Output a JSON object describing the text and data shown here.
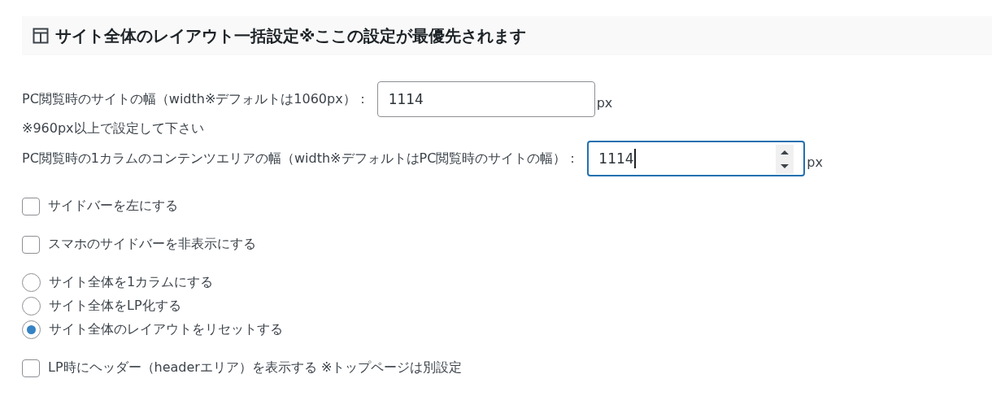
{
  "section": {
    "title": "サイト全体のレイアウト一括設定※ここの設定が最優先されます"
  },
  "fields": [
    {
      "label": "PC閲覧時のサイトの幅（width※デフォルトは1060px）：",
      "value": "1114",
      "unit": "px",
      "focused": false,
      "spinner": false,
      "note": "※960px以上で設定して下さい"
    },
    {
      "label": "PC閲覧時の1カラムのコンテンツエリアの幅（width※デフォルトはPC閲覧時のサイトの幅）：",
      "value": "1114",
      "unit": "px",
      "focused": true,
      "spinner": true
    }
  ],
  "option_groups": [
    [
      {
        "kind": "checkbox",
        "label": "サイドバーを左にする",
        "checked": false
      }
    ],
    [
      {
        "kind": "checkbox",
        "label": "スマホのサイドバーを非表示にする",
        "checked": false
      }
    ],
    [
      {
        "kind": "radio",
        "label": "サイト全体を1カラムにする",
        "selected": false
      },
      {
        "kind": "radio",
        "label": "サイト全体をLP化する",
        "selected": false
      },
      {
        "kind": "radio",
        "label": "サイト全体のレイアウトをリセットする",
        "selected": true
      }
    ],
    [
      {
        "kind": "checkbox",
        "label": "LP時にヘッダー（headerエリア）を表示する ※トップページは別設定",
        "checked": false
      }
    ]
  ]
}
